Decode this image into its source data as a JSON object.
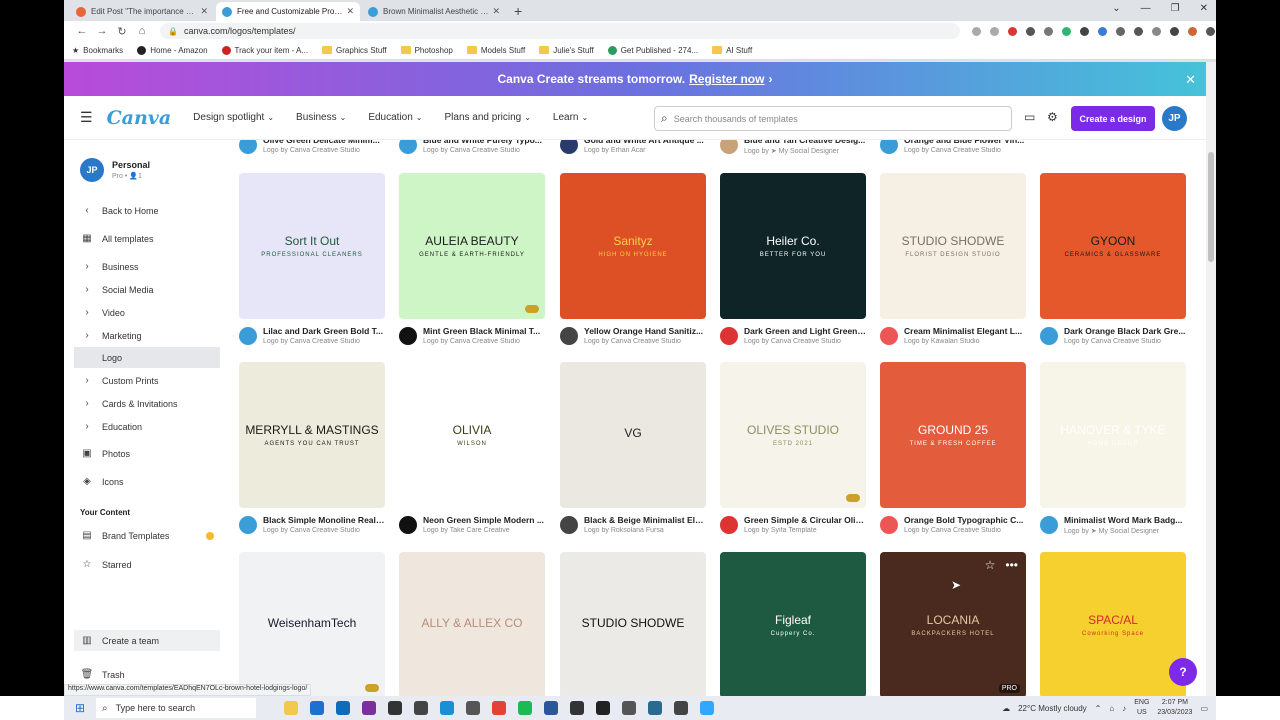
{
  "browser": {
    "tabs": [
      {
        "label": "Edit Post \"The importance of sty...",
        "favicon_color": "#e8643a",
        "active": false
      },
      {
        "label": "Free and Customizable Professio...",
        "favicon_color": "#3b9dd8",
        "active": true
      },
      {
        "label": "Brown Minimalist Aesthetic Life C...",
        "favicon_color": "#3b9dd8",
        "active": false
      }
    ],
    "new_tab_symbol": "+",
    "url": "canva.com/logos/templates/",
    "bookmarks": [
      {
        "label": "Bookmarks",
        "type": "star"
      },
      {
        "label": "Home - Amazon",
        "type": "site"
      },
      {
        "label": "Track your item - A...",
        "type": "site"
      },
      {
        "label": "Graphics Stuff",
        "type": "folder"
      },
      {
        "label": "Photoshop",
        "type": "folder"
      },
      {
        "label": "Models Stuff",
        "type": "folder"
      },
      {
        "label": "Julie's Stuff",
        "type": "folder"
      },
      {
        "label": "Get Published - 274...",
        "type": "site"
      },
      {
        "label": "AI Stuff",
        "type": "folder"
      }
    ]
  },
  "banner": {
    "text": "Canva Create streams tomorrow.",
    "link": "Register now",
    "arrow": "›",
    "close": "✕"
  },
  "header": {
    "logo": "Canva",
    "nav": [
      "Design spotlight",
      "Business",
      "Education",
      "Plans and pricing",
      "Learn"
    ],
    "search_placeholder": "Search thousands of templates",
    "create_label": "Create a design",
    "avatar_initials": "JP"
  },
  "sidebar": {
    "account_name": "Personal",
    "account_sub": "Pro • 👤1",
    "avatar_initials": "JP",
    "items": [
      {
        "label": "Back to Home",
        "icon": "‹"
      },
      {
        "label": "All templates",
        "icon": "▦"
      },
      {
        "label": "Business",
        "icon": "›"
      },
      {
        "label": "Social Media",
        "icon": "›"
      },
      {
        "label": "Video",
        "icon": "›"
      },
      {
        "label": "Marketing",
        "icon": "›"
      },
      {
        "label": "Logo",
        "icon": ""
      },
      {
        "label": "Custom Prints",
        "icon": "›"
      },
      {
        "label": "Cards & Invitations",
        "icon": "›"
      },
      {
        "label": "Education",
        "icon": "›"
      },
      {
        "label": "Photos",
        "icon": "▣"
      },
      {
        "label": "Icons",
        "icon": "◈"
      }
    ],
    "your_content_heading": "Your Content",
    "content_items": [
      {
        "label": "Brand Templates",
        "icon": "▤"
      },
      {
        "label": "Starred",
        "icon": "☆"
      }
    ],
    "create_team": "Create a team",
    "trash": "Trash"
  },
  "top_row_partial": [
    {
      "title": "Olive Green Delicate Minim...",
      "by": "Logo by Canva Creative Studio"
    },
    {
      "title": "Blue and White Purely Typo...",
      "by": "Logo by Canva Creative Studio"
    },
    {
      "title": "Gold and White Art Antique ...",
      "by": "Logo by Erhan Acar"
    },
    {
      "title": "Blue and Tan Creative Desig...",
      "by": "Logo by ➤ My Social Designer"
    },
    {
      "title": "Orange and Blue Flower Vin...",
      "by": "Logo by Canva Creative Studio"
    }
  ],
  "templates": [
    {
      "title": "Lilac and Dark Green Bold T...",
      "by": "Logo by Canva Creative Studio",
      "text": "Sort It Out",
      "sub": "PROFESSIONAL CLEANERS"
    },
    {
      "title": "Mint Green Black Minimal T...",
      "by": "Logo by Canva Creative Studio",
      "text": "AULEIA BEAUTY",
      "sub": "GENTLE & EARTH-FRIENDLY"
    },
    {
      "title": "Yellow Orange Hand Sanitiz...",
      "by": "Logo by Canva Creative Studio",
      "text": "Sanityz",
      "sub": "HIGH ON HYGIENE"
    },
    {
      "title": "Dark Green and Light Green ...",
      "by": "Logo by Canva Creative Studio",
      "text": "Heiler Co.",
      "sub": "BETTER FOR YOU"
    },
    {
      "title": "Cream Minimalist Elegant L...",
      "by": "Logo by Kawalan Studio",
      "text": "STUDIO SHODWE",
      "sub": "FLORIST DESIGN STUDIO"
    },
    {
      "title": "Dark Orange Black Dark Gre...",
      "by": "Logo by Canva Creative Studio",
      "text": "GYOON",
      "sub": "CERAMICS & GLASSWARE"
    },
    {
      "title": "Black Simple Monoline Real ...",
      "by": "Logo by Canva Creative Studio",
      "text": "MERRYLL & MASTINGS",
      "sub": "AGENTS YOU CAN TRUST"
    },
    {
      "title": "Neon Green Simple Modern ...",
      "by": "Logo by Take Care Creative",
      "text": "OLIVIA",
      "sub": "WILSON"
    },
    {
      "title": "Black & Beige Minimalist Ele...",
      "by": "Logo by Roksolana Fursa",
      "text": "VG",
      "sub": ""
    },
    {
      "title": "Green Simple & Circular Oliv...",
      "by": "Logo by Syifa Template",
      "text": "OLIVES STUDIO",
      "sub": "ESTD 2021"
    },
    {
      "title": "Orange Bold Typographic C...",
      "by": "Logo by Canva Creative Studio",
      "text": "GROUND 25",
      "sub": "TIME & FRESH COFFEE"
    },
    {
      "title": "Minimalist Word Mark Badg...",
      "by": "Logo by ➤ My Social Designer",
      "text": "HANOVER & TYKE",
      "sub": "HOME DECOR"
    },
    {
      "title": "",
      "by": "",
      "text": "WeisenhamTech",
      "sub": ""
    },
    {
      "title": "",
      "by": "",
      "text": "ALLY & ALLEX CO",
      "sub": ""
    },
    {
      "title": "",
      "by": "",
      "text": "STUDIO SHODWE",
      "sub": ""
    },
    {
      "title": "",
      "by": "",
      "text": "Figleaf",
      "sub": "Cuppery Co."
    },
    {
      "title": "",
      "by": "",
      "text": "LOCANIA",
      "sub": "BACKPACKERS HOTEL"
    },
    {
      "title": "",
      "by": "",
      "text": "SPAC/AL",
      "sub": "Coworking Space"
    }
  ],
  "badges": {
    "pro": "PRO"
  },
  "help_label": "?",
  "status_url": "https://www.canva.com/templates/EADhqEN7OLc-brown-hotel-lodgings-logo/",
  "taskbar": {
    "search_placeholder": "Type here to search",
    "weather": "22°C  Mostly cloudy",
    "lang": "ENG",
    "region": "US",
    "time": "2:07 PM",
    "date": "23/03/2023"
  },
  "colors": {
    "brand_purple": "#7d2ae8",
    "canva_blue": "#3b9dd8"
  }
}
